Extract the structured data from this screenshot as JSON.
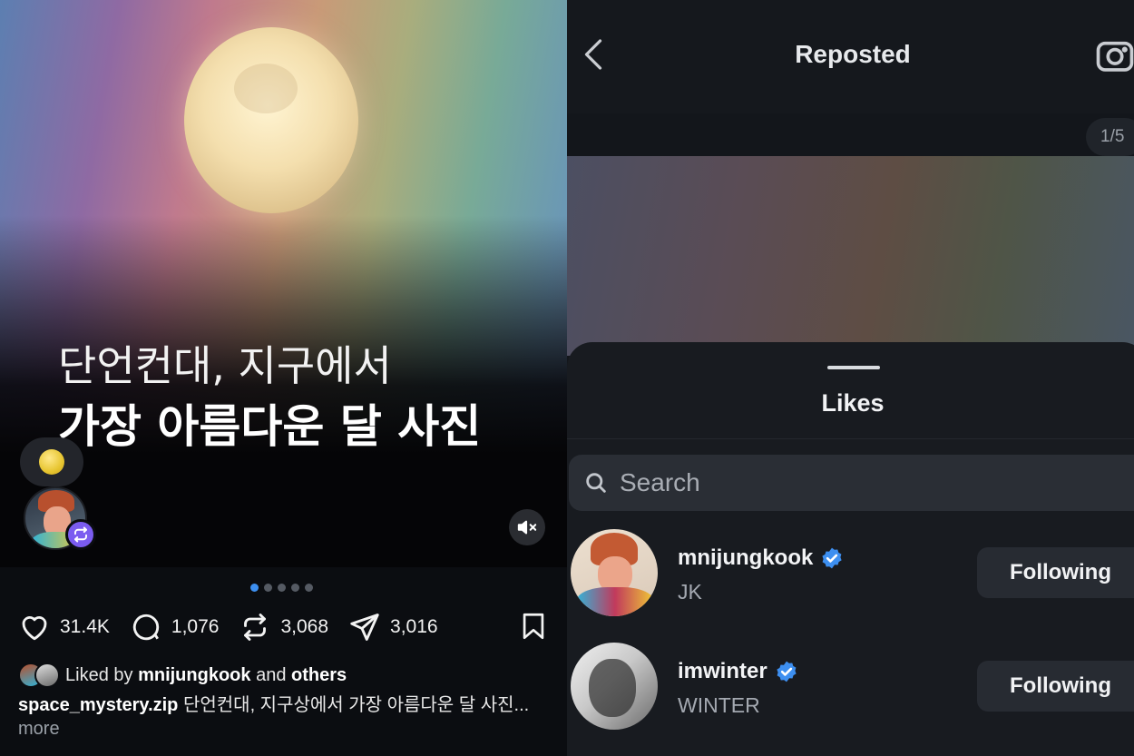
{
  "post": {
    "headline_line1": "단언컨대, 지구에서",
    "headline_line2": "가장 아름다운 달 사진",
    "carousel_total": 5,
    "carousel_active": 1,
    "stats": {
      "likes": "31.4K",
      "comments": "1,076",
      "reposts": "3,068",
      "shares": "3,016"
    },
    "liked_by": {
      "prefix": "Liked by",
      "user": "mnijungkook",
      "connector": "and",
      "others": "others"
    },
    "caption": {
      "username": "space_mystery.zip",
      "text": "단언컨대, 지구상에서 가장 아름다운 달 사진...",
      "more": "more"
    }
  },
  "reposted_view": {
    "title": "Reposted",
    "counter": "1/5"
  },
  "likes_sheet": {
    "title": "Likes",
    "search_placeholder": "Search",
    "users": [
      {
        "username": "mnijungkook",
        "display_name": "JK",
        "verified": true,
        "button": "Following"
      },
      {
        "username": "imwinter",
        "display_name": "WINTER",
        "verified": true,
        "button": "Following"
      }
    ]
  },
  "colors": {
    "accent": "#3d8ff0",
    "verified": "#3d8ff0",
    "repost_badge": "#7b5cf0"
  }
}
